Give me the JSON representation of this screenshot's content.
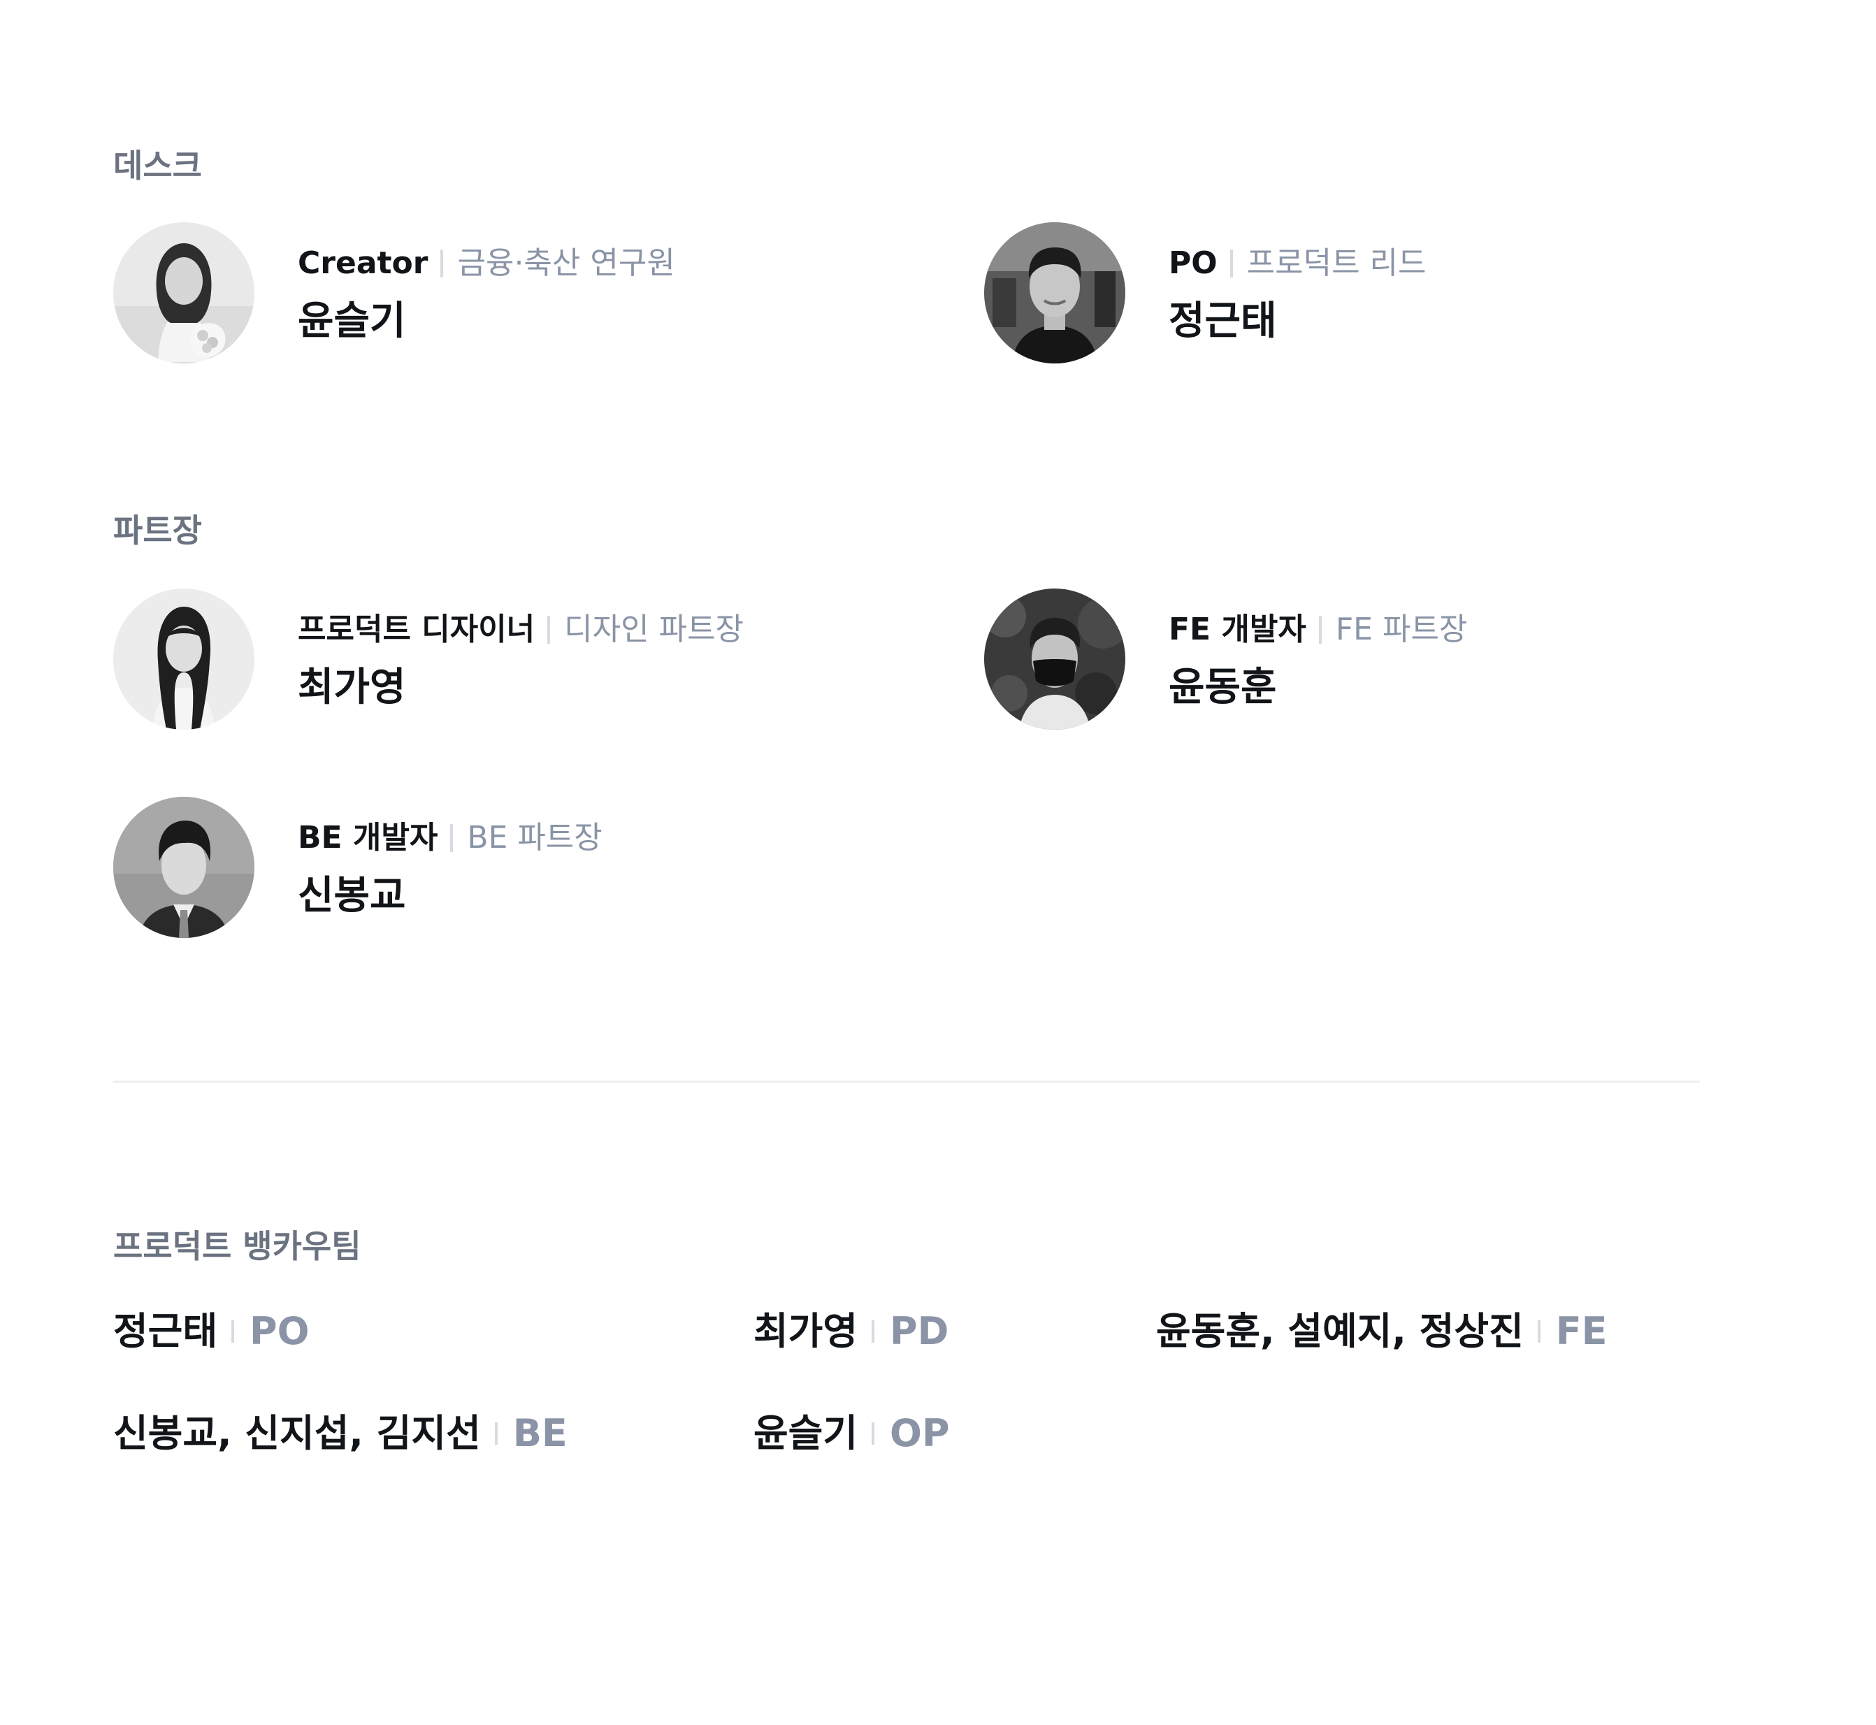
{
  "sections": {
    "desk": {
      "title": "데스크",
      "members": [
        {
          "role": "Creator",
          "subrole": "금융·축산 연구원",
          "name": "윤슬기",
          "avatar": "photo-avatar-woman"
        },
        {
          "role": "PO",
          "subrole": "프로덕트 리드",
          "name": "정근태",
          "avatar": "photo-avatar-man"
        }
      ]
    },
    "part_leads": {
      "title": "파트장",
      "members": [
        {
          "role": "프로덕트 디자이너",
          "subrole": "디자인 파트장",
          "name": "최가영",
          "avatar": "photo-avatar-woman"
        },
        {
          "role": "FE 개발자",
          "subrole": "FE 파트장",
          "name": "윤동훈",
          "avatar": "photo-avatar-man-mask"
        },
        {
          "role": "BE 개발자",
          "subrole": "BE 파트장",
          "name": "신봉교",
          "avatar": "photo-avatar-man-suit"
        }
      ]
    },
    "team": {
      "title": "프로덕트 뱅카우팀",
      "items": [
        {
          "names": "정근태",
          "role": "PO"
        },
        {
          "names": "최가영",
          "role": "PD"
        },
        {
          "names": "윤동훈, 설예지, 정상진",
          "role": "FE"
        },
        {
          "names": "신봉교, 신지섭, 김지선",
          "role": "BE"
        },
        {
          "names": "윤슬기",
          "role": "OP"
        }
      ]
    }
  },
  "colors": {
    "title": "#6b7280",
    "text": "#111418",
    "muted": "#8a94a6",
    "separator": "#d7dbe1",
    "divider": "#eceef1"
  }
}
